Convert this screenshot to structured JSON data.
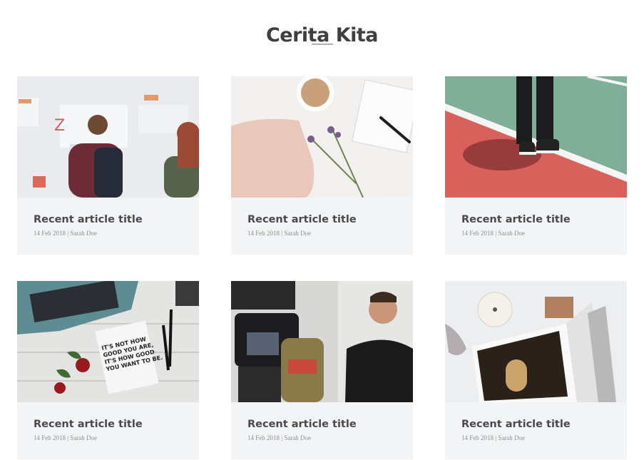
{
  "section": {
    "title": "Cerita Kita"
  },
  "articles": [
    {
      "title": "Recent article title",
      "date": "14 Feb 2018",
      "author": "Sarah Doe",
      "image": "office-whiteboard-photo"
    },
    {
      "title": "Recent article title",
      "date": "14 Feb 2018",
      "author": "Sarah Doe",
      "image": "coffee-knitting-lavender-photo"
    },
    {
      "title": "Recent article title",
      "date": "14 Feb 2018",
      "author": "Sarah Doe",
      "image": "tennis-court-sneakers-photo"
    },
    {
      "title": "Recent article title",
      "date": "14 Feb 2018",
      "author": "Sarah Doe",
      "image": "typewriter-book-roses-photo"
    },
    {
      "title": "Recent article title",
      "date": "14 Feb 2018",
      "author": "Sarah Doe",
      "image": "camera-studio-man-photo"
    },
    {
      "title": "Recent article title",
      "date": "14 Feb 2018",
      "author": "Sarah Doe",
      "image": "magazine-candle-photo"
    }
  ],
  "colors": {
    "heading": "#3f3f3f",
    "card_background": "#f3f4f6",
    "divider": "#aeb3bd"
  }
}
